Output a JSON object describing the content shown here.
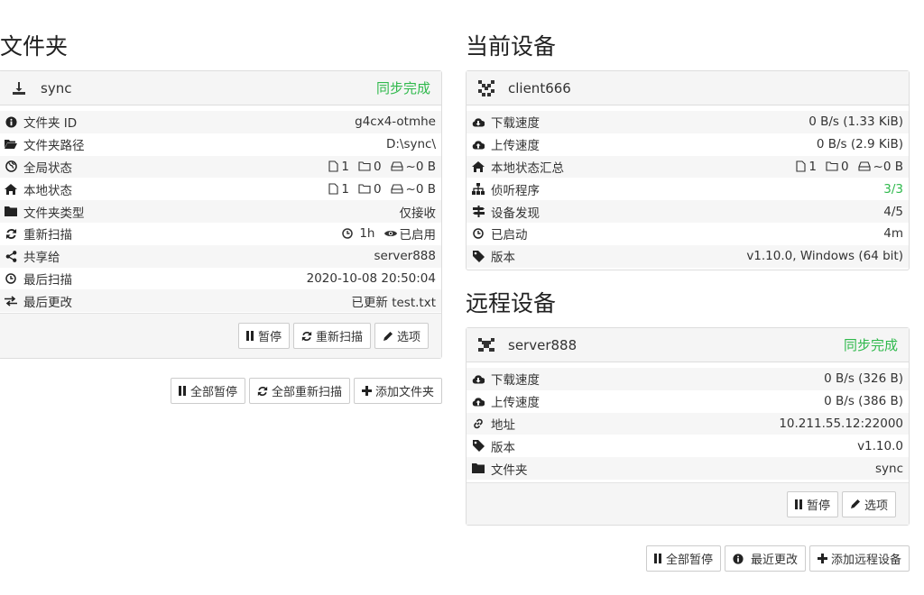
{
  "folders": {
    "title": "文件夹",
    "panel": {
      "name": "sync",
      "status": "同步完成",
      "rows": [
        {
          "label": "文件夹 ID",
          "value": "g4cx4-otmhe"
        },
        {
          "label": "文件夹路径",
          "value": "D:\\sync\\"
        },
        {
          "label": "全局状态",
          "files": "1",
          "dirs": "0",
          "size": "~0 B"
        },
        {
          "label": "本地状态",
          "files": "1",
          "dirs": "0",
          "size": "~0 B"
        },
        {
          "label": "文件夹类型",
          "value": "仅接收"
        },
        {
          "label": "重新扫描",
          "interval": "1h",
          "watch": "已启用"
        },
        {
          "label": "共享给",
          "value": "server888"
        },
        {
          "label": "最后扫描",
          "value": "2020-10-08 20:50:04"
        },
        {
          "label": "最后更改",
          "value": "已更新 test.txt"
        }
      ],
      "buttons": {
        "pause": "暂停",
        "rescan": "重新扫描",
        "options": "选项"
      }
    },
    "actions": {
      "pause_all": "全部暂停",
      "rescan_all": "全部重新扫描",
      "add_folder": "添加文件夹"
    }
  },
  "this_device": {
    "title": "当前设备",
    "name": "client666",
    "rows": [
      {
        "label": "下载速度",
        "value": "0 B/s (1.33 KiB)"
      },
      {
        "label": "上传速度",
        "value": "0 B/s (2.9 KiB)"
      },
      {
        "label": "本地状态汇总",
        "files": "1",
        "dirs": "0",
        "size": "~0 B"
      },
      {
        "label": "侦听程序",
        "value": "3/3"
      },
      {
        "label": "设备发现",
        "value": "4/5"
      },
      {
        "label": "已启动",
        "value": "4m"
      },
      {
        "label": "版本",
        "value": "v1.10.0, Windows (64 bit)"
      }
    ]
  },
  "remote": {
    "title": "远程设备",
    "panel": {
      "name": "server888",
      "status": "同步完成",
      "rows": [
        {
          "label": "下载速度",
          "value": "0 B/s (326 B)"
        },
        {
          "label": "上传速度",
          "value": "0 B/s (386 B)"
        },
        {
          "label": "地址",
          "value": "10.211.55.12:22000"
        },
        {
          "label": "版本",
          "value": "v1.10.0"
        },
        {
          "label": "文件夹",
          "value": "sync"
        }
      ],
      "buttons": {
        "pause": "暂停",
        "options": "选项"
      }
    },
    "actions": {
      "pause_all": "全部暂停",
      "recent_changes": "最近更改",
      "add_device": "添加远程设备"
    }
  },
  "colors": {
    "accent_green": "#2fb94c"
  }
}
